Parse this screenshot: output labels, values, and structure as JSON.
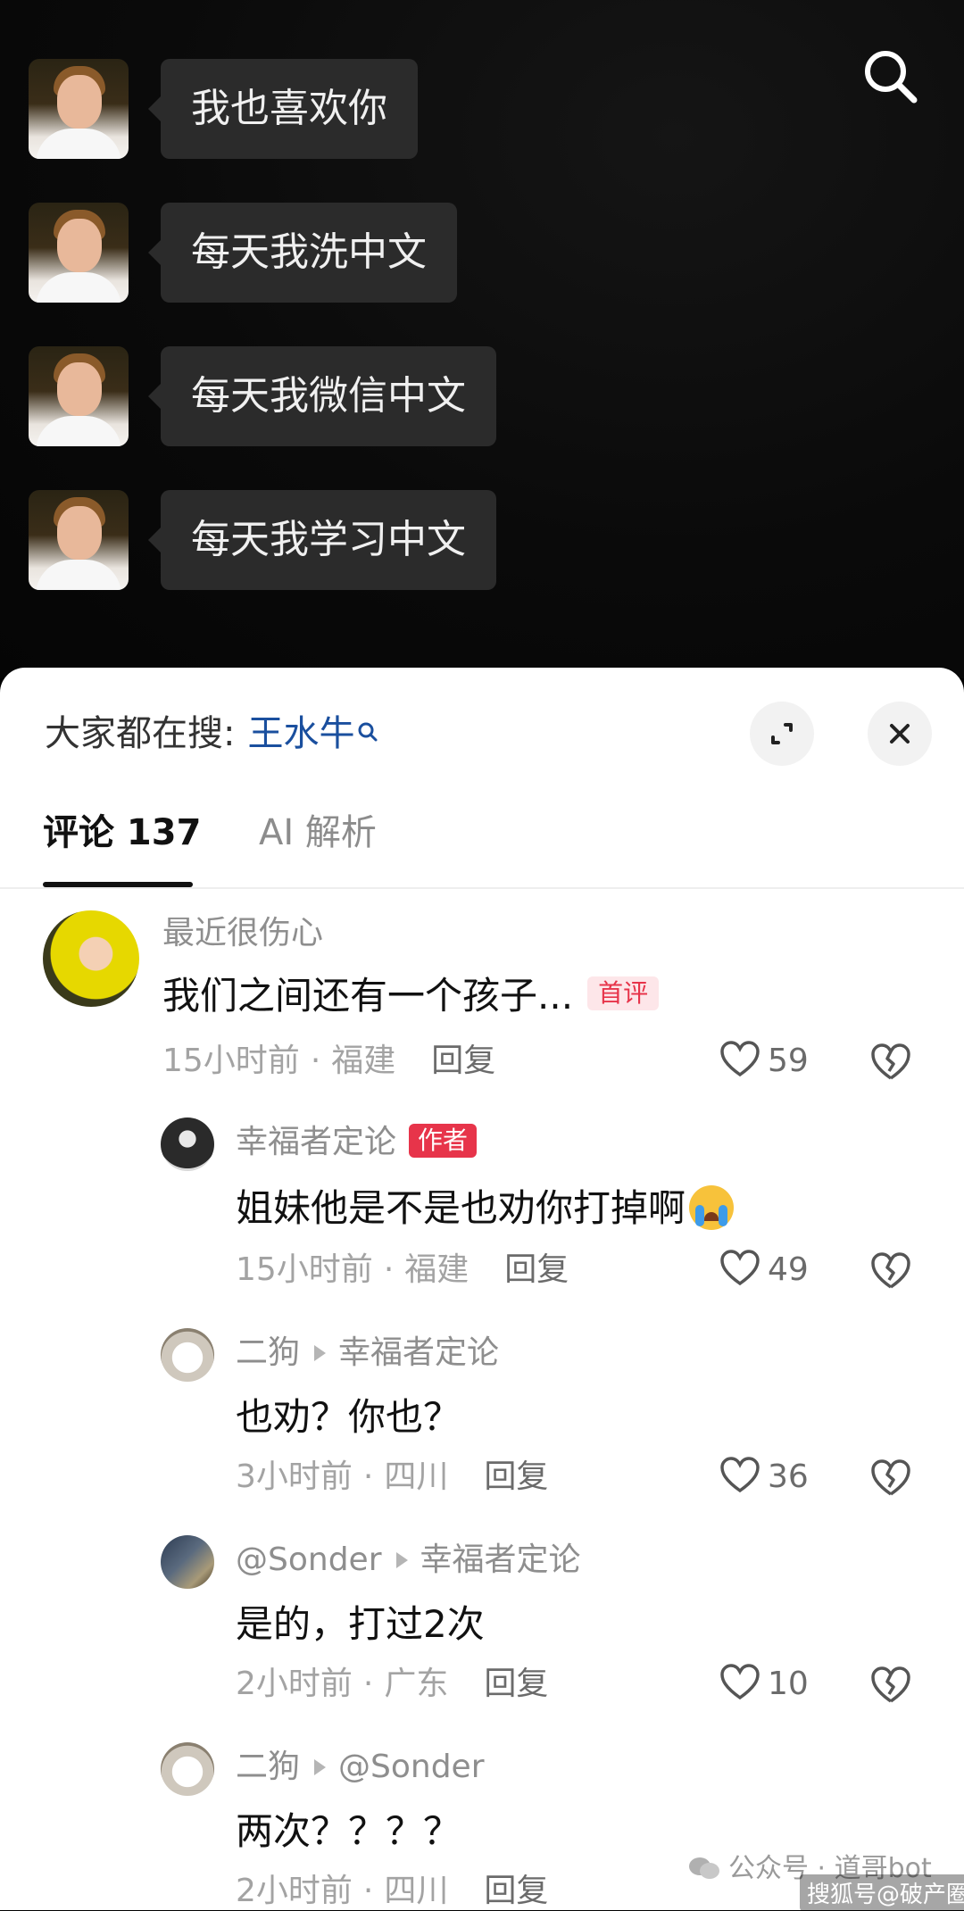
{
  "chat": {
    "messages": [
      {
        "text": "我也喜欢你"
      },
      {
        "text": "每天我洗中文"
      },
      {
        "text": "每天我微信中文"
      },
      {
        "text": "每天我学习中文"
      }
    ]
  },
  "sheet": {
    "trending_label": "大家都在搜:",
    "trending_term": "王水牛",
    "tabs": {
      "comments": "评论 137",
      "ai": "AI 解析"
    }
  },
  "comments": [
    {
      "author": "最近很伤心",
      "text": "我们之间还有一个孩子...",
      "badge": "首评",
      "time": "15小时前",
      "location": "福建",
      "reply": "回复",
      "likes": "59"
    },
    {
      "author": "幸福者定论",
      "author_badge": "作者",
      "text": "姐妹他是不是也劝你打掉啊",
      "time": "15小时前",
      "location": "福建",
      "reply": "回复",
      "likes": "49"
    },
    {
      "author": "二狗",
      "reply_to": "幸福者定论",
      "text": "也劝？你也？",
      "time": "3小时前",
      "location": "四川",
      "reply": "回复",
      "likes": "36"
    },
    {
      "author": "@Sonder",
      "reply_to": "幸福者定论",
      "text": "是的，打过2次",
      "time": "2小时前",
      "location": "广东",
      "reply": "回复",
      "likes": "10"
    },
    {
      "author": "二狗",
      "reply_to": "@Sonder",
      "text": "两次？？？？",
      "time": "2小时前",
      "location": "四川",
      "reply": "回复"
    }
  ],
  "watermark": {
    "text": "公众号 · 道哥bot",
    "text2": "搜狐号@破产圈"
  },
  "colors": {
    "accent_red": "#e7344a",
    "trend_blue": "#1a4f9e",
    "background_dark": "#000000"
  }
}
